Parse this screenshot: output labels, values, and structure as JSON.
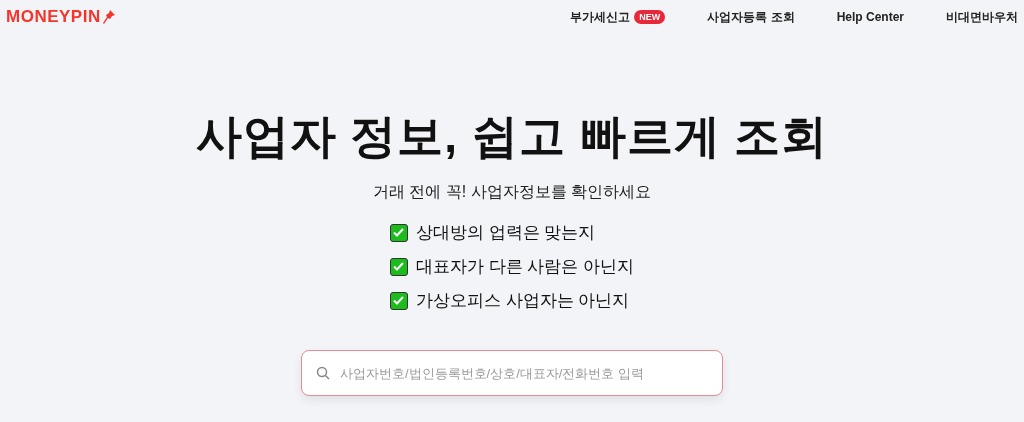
{
  "header": {
    "logo": "MONEYPIN",
    "nav": [
      {
        "label": "부가세신고",
        "badge": "NEW"
      },
      {
        "label": "사업자등록 조회"
      },
      {
        "label": "Help Center"
      },
      {
        "label": "비대면바우처"
      }
    ]
  },
  "hero": {
    "title": "사업자 정보, 쉽고 빠르게 조회",
    "subtitle": "거래 전에 꼭! 사업자정보를 확인하세요",
    "checklist": [
      {
        "label": "상대방의 업력은 맞는지",
        "checked": true
      },
      {
        "label": "대표자가 다른 사람은 아닌지",
        "checked": true
      },
      {
        "label": "가상오피스 사업자는 아닌지",
        "checked": true
      }
    ]
  },
  "search": {
    "placeholder": "사업자번호/법인등록번호/상호/대표자/전화번호 입력"
  }
}
